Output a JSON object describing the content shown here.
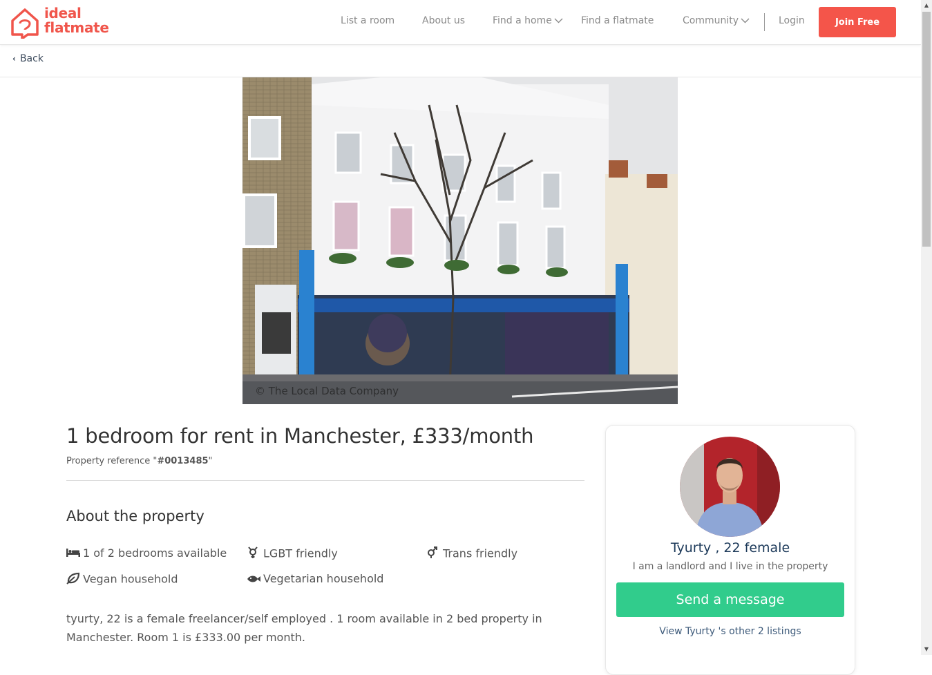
{
  "brand": {
    "line1": "ideal",
    "line2": "flatmate",
    "color": "#f0554b"
  },
  "nav": {
    "items": [
      {
        "label": "List a room",
        "has_dropdown": false
      },
      {
        "label": "About us",
        "has_dropdown": false
      },
      {
        "label": "Find a home",
        "has_dropdown": true
      },
      {
        "label": "Find a flatmate",
        "has_dropdown": false
      },
      {
        "label": "Community",
        "has_dropdown": true
      }
    ],
    "login": "Login",
    "join": "Join Free",
    "join_color": "#f4554a"
  },
  "back": {
    "label": "Back"
  },
  "photo": {
    "credit": "© The Local Data Company"
  },
  "listing": {
    "title": "1 bedroom for rent in Manchester, £333/month",
    "ref_prefix": "Property reference \"",
    "ref_value": "#0013485",
    "ref_suffix": "\"",
    "section_title": "About the property",
    "features": [
      {
        "icon": "bed-icon",
        "label": "1 of 2 bedrooms available"
      },
      {
        "icon": "lgbt-icon",
        "label": "LGBT friendly"
      },
      {
        "icon": "trans-icon",
        "label": "Trans friendly"
      },
      {
        "icon": "leaf-icon",
        "label": "Vegan household"
      },
      {
        "icon": "fish-icon",
        "label": "Vegetarian household"
      }
    ],
    "description": "tyurty, 22 is a female freelancer/self employed . 1 room available in 2 bed property in Manchester. Room 1 is £333.00 per month."
  },
  "owner": {
    "name": "Tyurty , 22 female",
    "subtitle": "I am a landlord and I live in the property",
    "message_button": "Send a message",
    "message_color": "#31cc8c",
    "other_listings": "View Tyurty 's other 2 listings"
  }
}
